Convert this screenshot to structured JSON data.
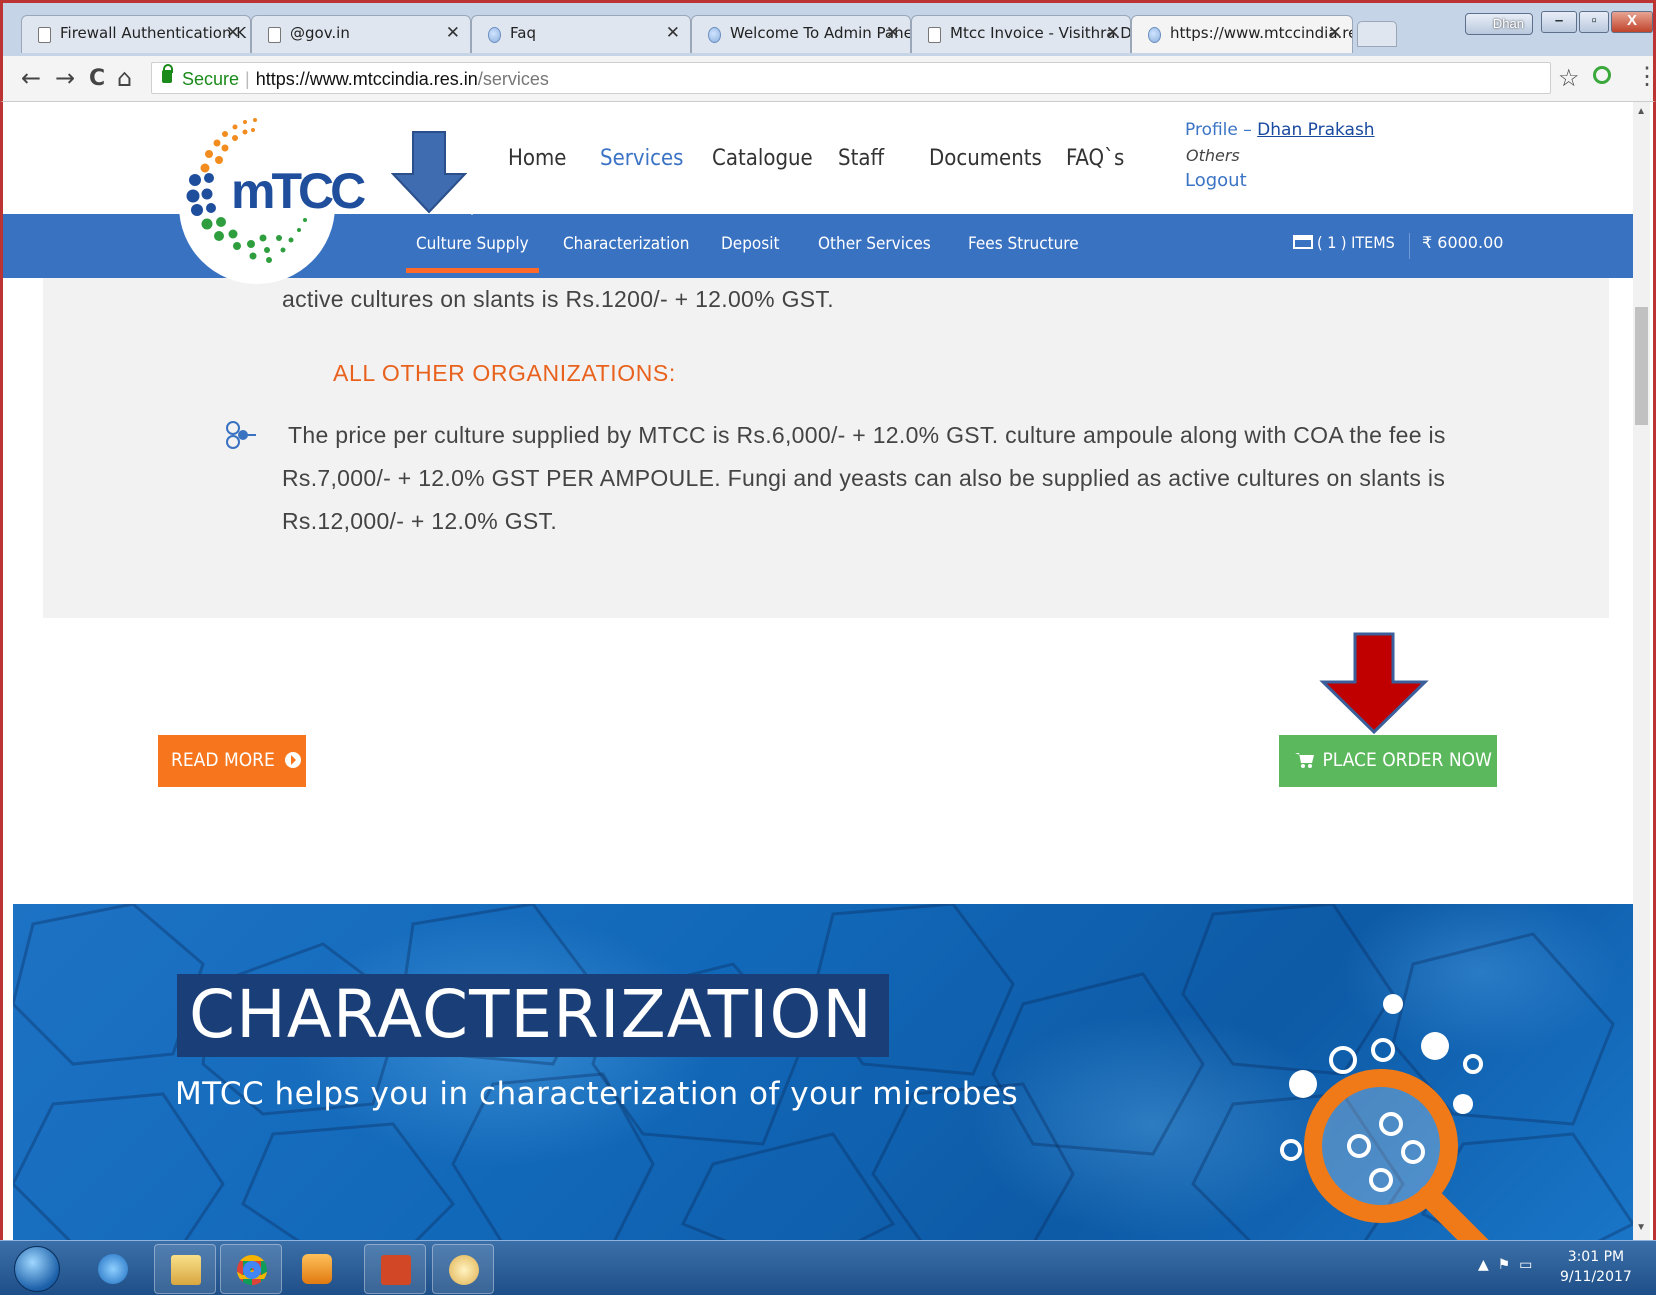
{
  "browser": {
    "tabs": [
      {
        "title": "Firewall Authentication K",
        "close": "✕"
      },
      {
        "title": "@gov.in",
        "close": "✕"
      },
      {
        "title": "Faq",
        "close": "✕"
      },
      {
        "title": "Welcome To Admin Pane",
        "close": "✕"
      },
      {
        "title": "Mtcc Invoice - Visithra.D",
        "close": "✕"
      },
      {
        "title": "https://www.mtccindia.re",
        "close": "✕"
      }
    ],
    "profile_chip": "Dhan",
    "window_buttons": {
      "minimize": "–",
      "restore": "▫",
      "close": "X"
    },
    "nav": {
      "back": "←",
      "forward": "→",
      "reload": "C",
      "home": "⌂"
    },
    "address": {
      "secure_label": "Secure",
      "separator": "|",
      "host": "https://www.mtccindia.res.in",
      "path": "/services"
    },
    "star": "☆",
    "menu": "⋮"
  },
  "site": {
    "logo_text": "mTCC",
    "main_nav": [
      "Home",
      "Services",
      "Catalogue",
      "Staff",
      "Documents",
      "FAQ`s"
    ],
    "profile_label": "Profile –",
    "profile_name": "Dhan Prakash",
    "profile_role": "Others",
    "logout": "Logout",
    "sub_nav": [
      "Culture Supply",
      "Characterization",
      "Deposit",
      "Other Services",
      "Fees Structure"
    ],
    "cart_items": "( 1 ) ITEMS",
    "cart_total": "₹ 6000.00"
  },
  "content": {
    "para_top": "active cultures on slants is Rs.1200/- + 12.00% GST.",
    "heading": "ALL OTHER ORGANIZATIONS:",
    "para_lines": [
      "The price per culture supplied by MTCC is Rs.6,000/- + 12.0%  GST. culture ampoule along with COA the fee is",
      "Rs.7,000/- + 12.0%  GST PER AMPOULE. Fungi and yeasts can also be supplied as active cultures on slants is",
      "Rs.12,000/- + 12.0%  GST."
    ],
    "read_more": "READ MORE",
    "place_order": "PLACE ORDER NOW"
  },
  "banner": {
    "title": "CHARACTERIZATION",
    "subtitle": "MTCC helps you in characterization of your microbes"
  },
  "taskbar": {
    "time": "3:01 PM",
    "date": "9/11/2017"
  },
  "colors": {
    "accent_blue": "#3a72c2",
    "orange": "#f7761d",
    "green": "#5cb85c",
    "annotation_arrow_blue": "#3f6bb0",
    "annotation_arrow_red": "#c00000"
  }
}
